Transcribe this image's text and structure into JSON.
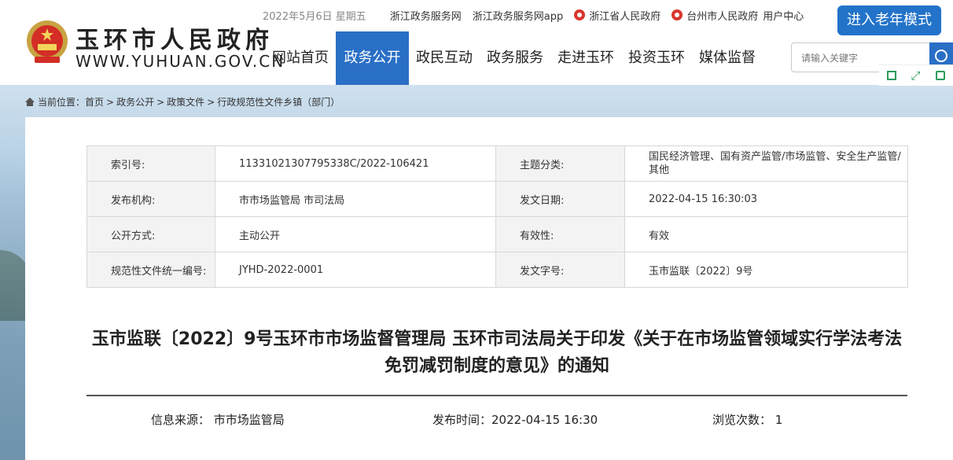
{
  "header": {
    "site_title": "玉环市人民政府",
    "site_domain": "WWW.YUHUAN.GOV.CN",
    "date": "2022年5月6日 星期五",
    "top_links": [
      {
        "label": "浙江政务服务网",
        "icon": ""
      },
      {
        "label": "浙江政务服务网app",
        "icon": ""
      },
      {
        "label": "浙江省人民政府",
        "icon": "emblem-icon"
      },
      {
        "label": "台州市人民政府",
        "icon": "emblem-icon"
      },
      {
        "label": "用户中心",
        "icon": ""
      }
    ],
    "elder_mode": "进入老年模式",
    "nav": [
      "网站首页",
      "政务公开",
      "政民互动",
      "政务服务",
      "走进玉环",
      "投资玉环",
      "媒体监督"
    ],
    "nav_active": "政务公开",
    "search_placeholder": "请输入关键字"
  },
  "breadcrumb": {
    "label": "当前位置：",
    "items": [
      "首页",
      "政务公开",
      "政策文件",
      "行政规范性文件乡镇（部门）"
    ]
  },
  "meta": {
    "rows": [
      [
        "索引号:",
        "11331021307795338C/2022-106421",
        "主题分类:",
        "国民经济管理、国有资产监管/市场监管、安全生产监管/其他"
      ],
      [
        "发布机构:",
        "市市场监管局 市司法局",
        "发文日期:",
        "2022-04-15 16:30:03"
      ],
      [
        "公开方式:",
        "主动公开",
        "有效性:",
        "有效"
      ],
      [
        "规范性文件统一编号:",
        "JYHD-2022-0001",
        "发文字号:",
        "玉市监联〔2022〕9号"
      ]
    ]
  },
  "document": {
    "title": "玉市监联〔2022〕9号玉环市市场监督管理局 玉环市司法局关于印发《关于在市场监管领域实行学法考法免罚减罚制度的意见》的通知",
    "source_label": "信息来源：",
    "source": "市市场监管局",
    "publish_label": "发布时间：",
    "publish_time": "2022-04-15 16:30",
    "views_label": "浏览次数：",
    "views": "1"
  },
  "colors": {
    "nav_active_bg": "#2a6fc6",
    "elder_button_bg": "#2273c9",
    "tool_icon": "#2e9b5b"
  }
}
